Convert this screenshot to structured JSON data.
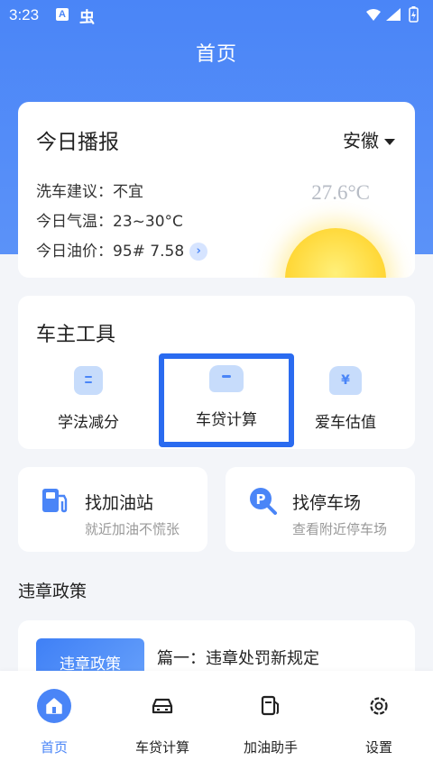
{
  "status_bar": {
    "time": "3:23",
    "notif_a": "A",
    "notif_b": "虫"
  },
  "page": {
    "title": "首页"
  },
  "broadcast": {
    "title": "今日播报",
    "region": "安徽",
    "wash_label": "洗车建议：",
    "wash_value": "不宜",
    "temp_label": "今日气温：",
    "temp_value": "23~30°C",
    "fuel_label": "今日油价：",
    "fuel_value": "95# 7.58",
    "current_temp": "27.6°C"
  },
  "tools": {
    "title": "车主工具",
    "items": [
      {
        "label": "学法减分",
        "icon": "book-icon"
      },
      {
        "label": "车贷计算",
        "icon": "car-icon"
      },
      {
        "label": "爱车估值",
        "icon": "yen-car-icon"
      }
    ]
  },
  "quick": [
    {
      "title": "找加油站",
      "subtitle": "就近加油不慌张",
      "icon": "fuel-pump-icon"
    },
    {
      "title": "找停车场",
      "subtitle": "查看附近停车场",
      "icon": "parking-search-icon"
    }
  ],
  "policy": {
    "title": "违章政策",
    "articles": [
      {
        "thumb": "违章政策",
        "title": "篇一：违章处罚新规定"
      }
    ]
  },
  "tabbar": {
    "items": [
      {
        "label": "首页",
        "icon": "home-icon"
      },
      {
        "label": "车贷计算",
        "icon": "car-icon"
      },
      {
        "label": "加油助手",
        "icon": "fuel-pump-icon"
      },
      {
        "label": "设置",
        "icon": "gear-icon"
      }
    ]
  },
  "colors": {
    "primary": "#4a85f7",
    "selection": "#2a6bf0",
    "sun": "#ffd93b"
  }
}
